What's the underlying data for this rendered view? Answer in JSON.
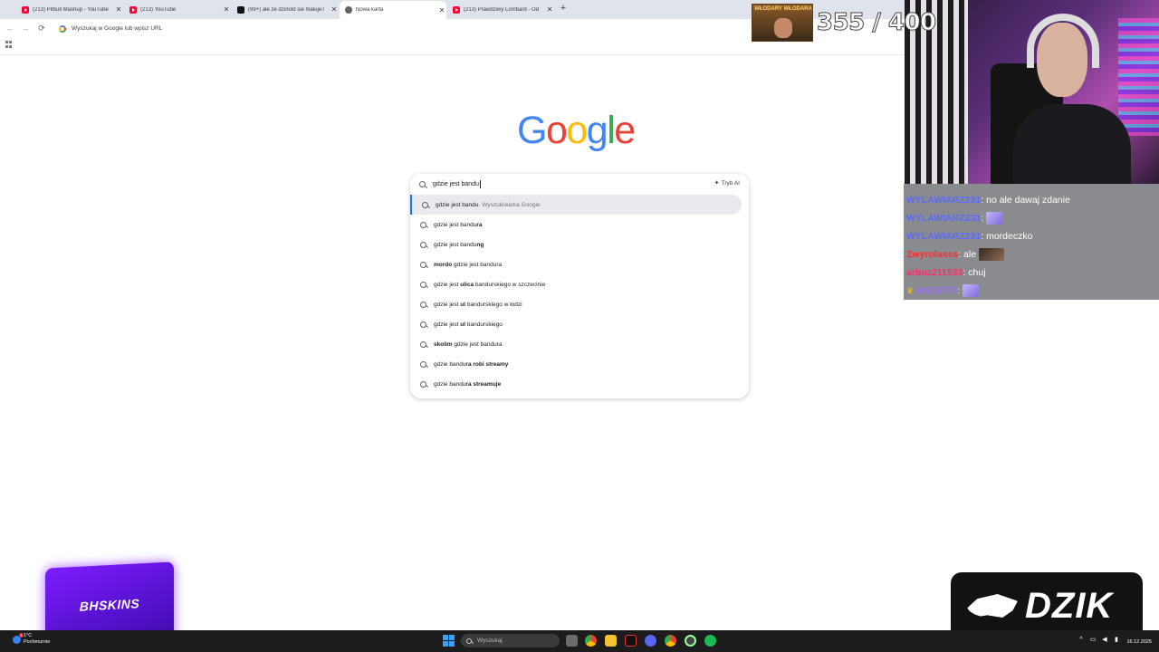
{
  "tabs": [
    {
      "title": "(213) Pitbull Mashup - YouTube",
      "icon": "youtube-icon",
      "active": false
    },
    {
      "title": "(213) YouTube",
      "icon": "youtube-icon",
      "active": false
    },
    {
      "title": "(99+) ale ze dzinold sie małujeT",
      "icon": "tiktok-icon",
      "active": false
    },
    {
      "title": "Nowa karta",
      "icon": "chrome-icon",
      "active": true
    },
    {
      "title": "(213) Prawdziwy Lombard - Od",
      "icon": "youtube-icon",
      "active": false
    }
  ],
  "omnibox": {
    "placeholder": "Wyszukaj w Google lub wpisz URL"
  },
  "logo": {
    "letters": [
      "G",
      "o",
      "o",
      "g",
      "l",
      "e"
    ]
  },
  "search": {
    "query": "gdzie jest bandu",
    "ai_mode_label": "Tryb AI",
    "suggestions": [
      {
        "prefix": "gdzie jest bandu",
        "bold": "",
        "suffix": "",
        "desc": " - Wyszukiwarka Google"
      },
      {
        "prefix": "gdzie jest bandu",
        "bold": "ra",
        "suffix": "",
        "desc": ""
      },
      {
        "prefix": "gdzie jest bandu",
        "bold": "ng",
        "suffix": "",
        "desc": ""
      },
      {
        "prefix": "",
        "bold": "mordo ",
        "suffix": "gdzie jest bandura",
        "desc": ""
      },
      {
        "prefix": "gdzie jest ",
        "bold": "ulica",
        "suffix": " bandurskiego w szczecinie",
        "desc": ""
      },
      {
        "prefix": "gdzie jest ",
        "bold": "ul",
        "suffix": " bandurskiego w łodzi",
        "desc": ""
      },
      {
        "prefix": "gdzie jest ",
        "bold": "ul",
        "suffix": " bandurskiego",
        "desc": ""
      },
      {
        "prefix": "",
        "bold": "skolim ",
        "suffix": "gdzie jest bandura",
        "desc": ""
      },
      {
        "prefix": "gdzie bandu",
        "bold": "ra robi streamy",
        "suffix": "",
        "desc": ""
      },
      {
        "prefix": "gdzie bandu",
        "bold": "ra streamuje",
        "suffix": "",
        "desc": ""
      }
    ]
  },
  "overlay": {
    "goal_banner": "WŁODARY WŁODARA",
    "goal_counter": "355 / 400",
    "chat": [
      {
        "user": "WYLAWIARZ231",
        "user_color": "#5a6bff",
        "message": ": no ale dawaj zdanie",
        "emote": ""
      },
      {
        "user": "WYLAWIARZ231",
        "user_color": "#5a6bff",
        "message": ":",
        "emote": "e1"
      },
      {
        "user": "WYLAWIARZ231",
        "user_color": "#5a6bff",
        "message": ": mordeczko",
        "emote": ""
      },
      {
        "user": "Zwyrolasss",
        "user_color": "#ff2d2d",
        "message": ": ale",
        "emote": "e2"
      },
      {
        "user": "arbuz211533",
        "user_color": "#ff2d6e",
        "message": ": chuj",
        "emote": ""
      },
      {
        "user": "AXES777",
        "user_color": "#9b6bff",
        "message": ":",
        "emote": "e1"
      }
    ],
    "sponsor": "DZIK",
    "brand_box": "BHSKINS"
  },
  "taskbar": {
    "weather_temp": "1°C",
    "weather_desc": "Pochmurnie",
    "search_placeholder": "Wyszukaj",
    "date": "16.12.2025"
  },
  "colors": {
    "accent": "#1a73e8",
    "taskbar": "#1c1c1c",
    "chat_bg": "#8a8b8e"
  }
}
